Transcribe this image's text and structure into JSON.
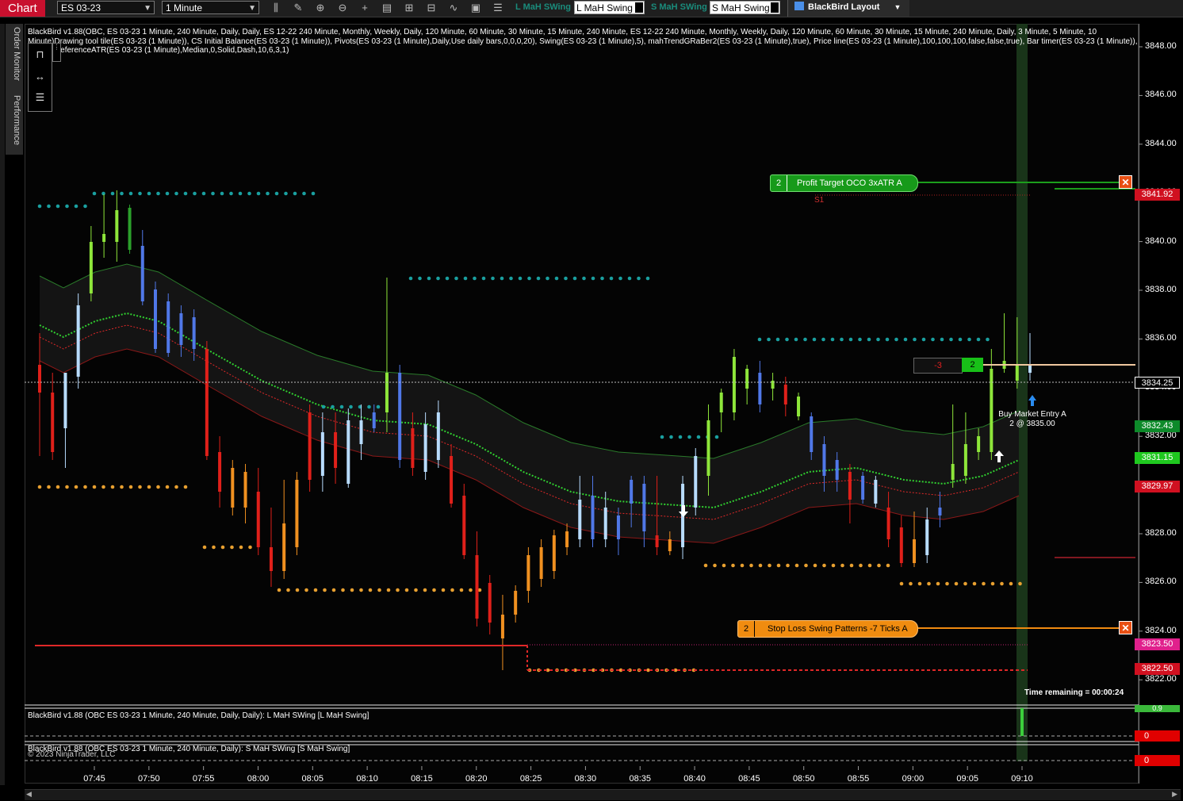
{
  "toolbar": {
    "chart_tab": "Chart",
    "instrument": "ES 03-23",
    "interval": "1 Minute",
    "long_label": "L MaH SWing",
    "long_value": "L MaH Swing",
    "short_label": "S MaH SWing",
    "short_value": "S MaH Swing",
    "layout": "BlackBird Layout"
  },
  "sidebar": {
    "tab1": "Order Monitor",
    "tab2": "Performance"
  },
  "indicator_info": "BlackBird v1.88(OBC, ES 03-23 1 Minute, 240 Minute, Daily, Daily, ES 12-22 240 Minute, Monthly, Weekly, Daily, 120 Minute, 60 Minute, 30 Minute, 15 Minute, 240 Minute, ES 12-22 240 Minute, Monthly, Weekly, Daily, 120 Minute, 60 Minute, 30 Minute, 15 Minute, 240 Minute, Daily, 3 Minute, 5 Minute, 10 Minute)Drawing tool tile(ES 03-23 (1 Minute)), CS Initial Balance(ES 03-23 (1 Minute)), Pivots(ES 03-23 (1 Minute),Daily,Use daily bars,0,0,0,20), Swing(ES 03-23 (1 Minute),5), mahTrendGRaBer2(ES 03-23 (1 Minute),true), Price line(ES 03-23 (1 Minute),100,100,100,false,false,true), Bar timer(ES 03-23 (1 Minute)), gbPriceReferenceATR(ES 03-23 (1 Minute),Median,0,Solid,Dash,10,6,3,1)",
  "y_axis": [
    "3848.00",
    "3846.00",
    "3844.00",
    "3842.00",
    "3840.00",
    "3838.00",
    "3836.00",
    "3834.00",
    "3832.00",
    "3830.00",
    "3828.00",
    "3826.00",
    "3824.00",
    "3822.00"
  ],
  "x_axis": [
    "07:45",
    "07:50",
    "07:55",
    "08:00",
    "08:05",
    "08:10",
    "08:15",
    "08:20",
    "08:25",
    "08:30",
    "08:35",
    "08:40",
    "08:45",
    "08:50",
    "08:55",
    "09:00",
    "09:05",
    "09:10"
  ],
  "price_tags": [
    {
      "text": "3841.92",
      "color": "#d01020"
    },
    {
      "text": "3834.25",
      "color": "#000000"
    },
    {
      "text": "3832.43",
      "color": "#0d8a2a"
    },
    {
      "text": "3831.15",
      "color": "#1fc81f"
    },
    {
      "text": "3829.97",
      "color": "#d01020"
    },
    {
      "text": "3823.50",
      "color": "#e0208c"
    },
    {
      "text": "3822.50",
      "color": "#d01020"
    }
  ],
  "orders": {
    "profit_target": {
      "qty": "2",
      "label": "Profit Target OCO  3xATR A"
    },
    "stop_loss": {
      "qty": "2",
      "label": "Stop Loss Swing Patterns -7 Ticks A"
    },
    "position_pnl": "-3",
    "position_qty": "2",
    "close_icon": "close-icon"
  },
  "annotations": {
    "pivot": "S1",
    "entry_line1": "Buy Market Entry A",
    "entry_line2": "2 @ 3835.00",
    "timer": "Time remaining = 00:00:24"
  },
  "subpanels": {
    "long_title": "BlackBird v1.88 (OBC ES 03-23 1 Minute, 240 Minute, Daily, Daily): L MaH SWing  [L MaH Swing]",
    "long_top": "0.9",
    "long_bottom": "0",
    "short_title": "BlackBird v1.88 (OBC ES 03-23 1 Minute, 240 Minute, Daily): S MaH SWing  [S MaH Swing]",
    "short_bottom": "0",
    "copyright": "© 2023 NinjaTrader, LLC"
  },
  "colors": {
    "up_green": "#8ee63a",
    "down_red": "#e0201a",
    "up_blue": "#b8dcff",
    "down_blue": "#5078e8",
    "orange": "#f09020",
    "teal_dots": "#1aa0a0",
    "gold_dots": "#e8a030"
  }
}
